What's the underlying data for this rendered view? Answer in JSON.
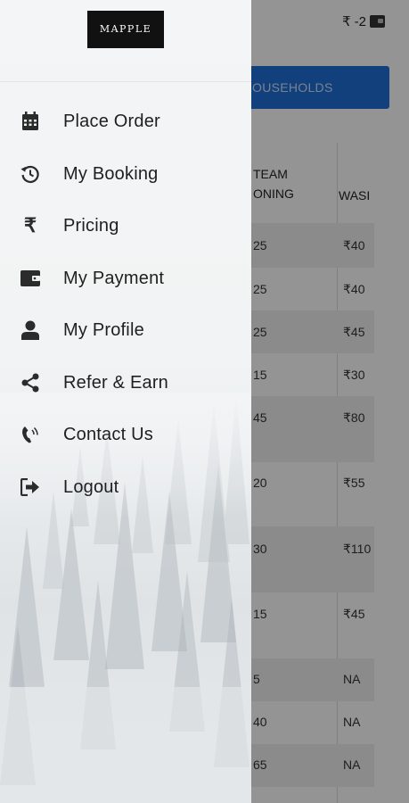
{
  "header": {
    "wallet_text": "₹ -2"
  },
  "background": {
    "households_label": "OUSEHOLDS",
    "table_headers": {
      "col1": "TEAM\nONING",
      "col2": "WASI"
    },
    "rows": [
      {
        "c1": "25",
        "c2": "₹40"
      },
      {
        "c1": "25",
        "c2": "₹40"
      },
      {
        "c1": "25",
        "c2": "₹45"
      },
      {
        "c1": "15",
        "c2": "₹30"
      },
      {
        "c1": "45",
        "c2": "₹80"
      },
      {
        "c1": "20",
        "c2": "₹55"
      },
      {
        "c1": "30",
        "c2": "₹110"
      },
      {
        "c1": "15",
        "c2": "₹45"
      },
      {
        "c1": "5",
        "c2": "NA"
      },
      {
        "c1": "40",
        "c2": "NA"
      },
      {
        "c1": "65",
        "c2": "NA"
      }
    ]
  },
  "drawer": {
    "logo_text": "MAPPLE",
    "menu": [
      {
        "label": "Place Order",
        "icon": "calendar-icon"
      },
      {
        "label": "My Booking",
        "icon": "history-icon"
      },
      {
        "label": "Pricing",
        "icon": "rupee-icon"
      },
      {
        "label": "My Payment",
        "icon": "wallet-icon"
      },
      {
        "label": "My Profile",
        "icon": "user-icon"
      },
      {
        "label": "Refer & Earn",
        "icon": "share-icon"
      },
      {
        "label": "Contact Us",
        "icon": "phone-icon"
      },
      {
        "label": "Logout",
        "icon": "logout-icon"
      }
    ]
  },
  "colors": {
    "primary_button": "#1f6fd8",
    "scrim": "rgba(0,0,0,0.42)",
    "text": "#1f1f1f"
  }
}
